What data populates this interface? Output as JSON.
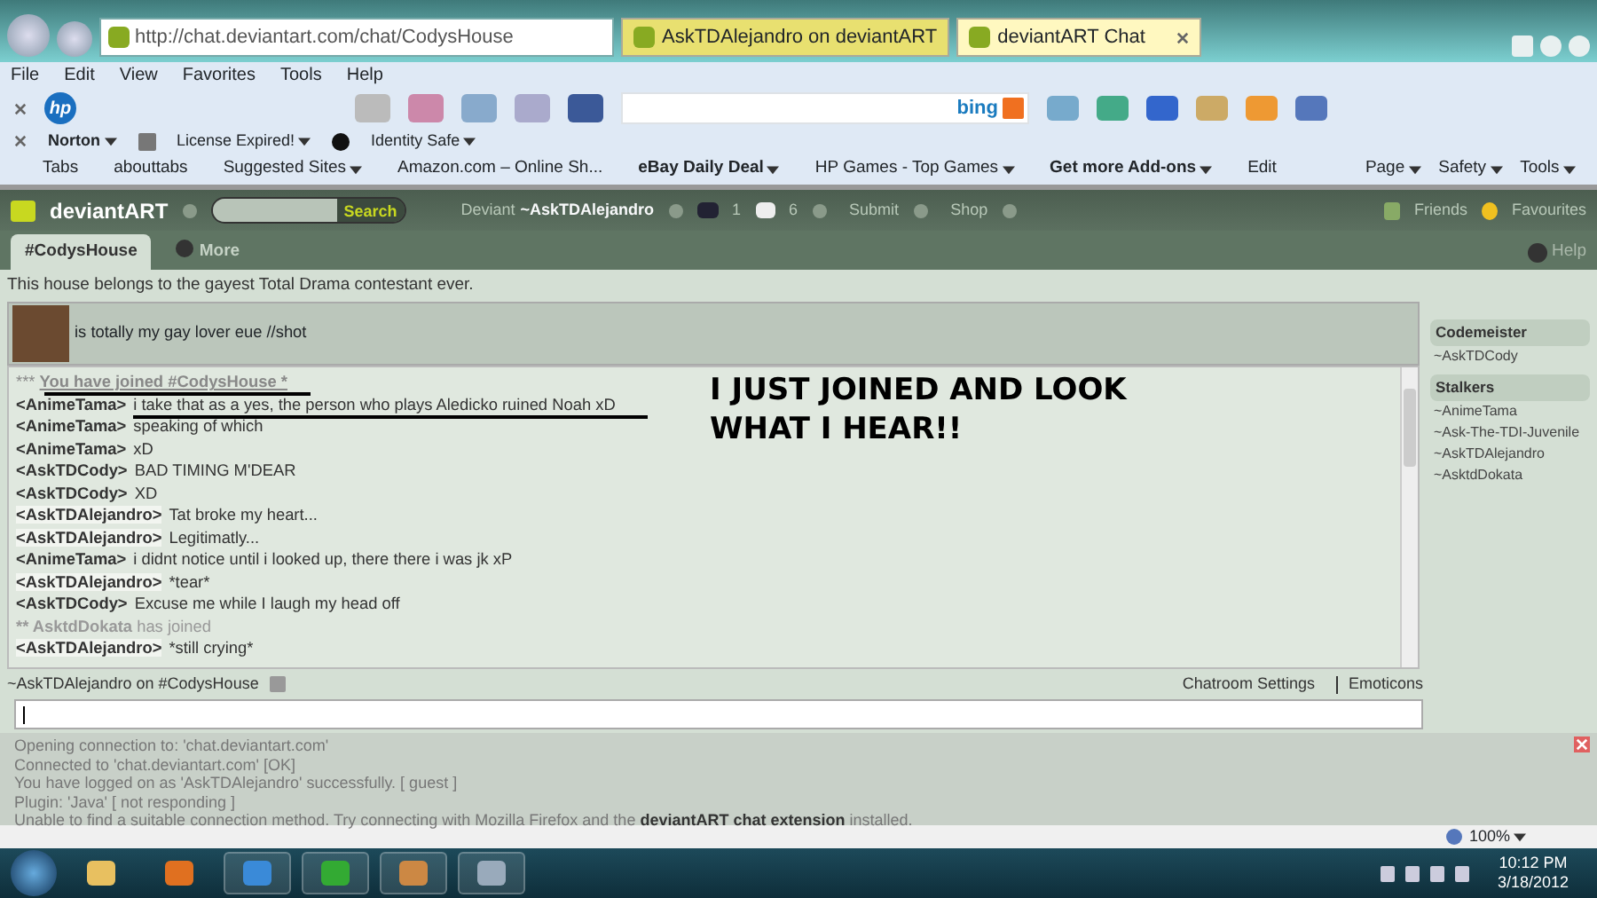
{
  "browser": {
    "address": "http://chat.deviantart.com/chat/CodysHouse",
    "tabs": [
      {
        "label": "AskTDAlejandro on deviantART",
        "selected": false
      },
      {
        "label": "deviantART Chat",
        "selected": true
      }
    ],
    "menu": [
      "File",
      "Edit",
      "View",
      "Favorites",
      "Tools",
      "Help"
    ],
    "hp_logo": "hp",
    "search_logo": "bing",
    "norton": {
      "brand": "Norton",
      "items": [
        "License Expired!",
        "Identity Safe"
      ]
    },
    "favorites": [
      "Tabs",
      "abouttabs",
      "Suggested Sites",
      "Amazon.com – Online Sh...",
      "eBay Daily Deal",
      "HP Games - Top Games",
      "Get more Add-ons",
      "Edit"
    ],
    "command_bar": [
      "Page",
      "Safety",
      "Tools"
    ]
  },
  "header": {
    "logo": "deviantART",
    "search_button": "Search",
    "user_prefix": "Deviant",
    "user": "~AskTDAlejandro",
    "watch_count": "1",
    "message_count": "6",
    "nav": [
      "Submit",
      "Shop"
    ],
    "right": [
      "Friends",
      "Favourites"
    ]
  },
  "room_tabs": [
    {
      "label": "#CodysHouse",
      "selected": true
    },
    {
      "label": "More",
      "selected": false
    }
  ],
  "help": "Help",
  "topic": "This house belongs to the gayest Total Drama contestant ever.",
  "pinned": {
    "text": "is totally my gay lover eue //shot"
  },
  "messages": [
    {
      "kind": "system",
      "prefix": "***",
      "text": "You have joined #CodysHouse *"
    },
    {
      "kind": "message",
      "user": "<AnimeTama>",
      "self": false,
      "text": "i take that as a yes, the person who plays Aledicko ruined Noah xD"
    },
    {
      "kind": "message",
      "user": "<AnimeTama>",
      "self": false,
      "text": "speaking of which"
    },
    {
      "kind": "message",
      "user": "<AnimeTama>",
      "self": false,
      "text": "xD"
    },
    {
      "kind": "message",
      "user": "<AskTDCody>",
      "self": false,
      "text": "BAD TIMING M'DEAR"
    },
    {
      "kind": "message",
      "user": "<AskTDCody>",
      "self": false,
      "text": "XD"
    },
    {
      "kind": "message",
      "user": "<AskTDAlejandro>",
      "self": true,
      "text": "Tat broke my heart..."
    },
    {
      "kind": "message",
      "user": "<AskTDAlejandro>",
      "self": true,
      "text": "Legitimatly..."
    },
    {
      "kind": "message",
      "user": "<AnimeTama>",
      "self": false,
      "text": "i didnt notice until i looked up, there there i was jk xP"
    },
    {
      "kind": "message",
      "user": "<AskTDAlejandro>",
      "self": true,
      "text": "*tear*"
    },
    {
      "kind": "message",
      "user": "<AskTDCody>",
      "self": false,
      "text": "Excuse me while I laugh my head off"
    },
    {
      "kind": "join",
      "prefix": "**",
      "user": "AsktdDokata",
      "text": "has joined"
    },
    {
      "kind": "message",
      "user": "<AskTDAlejandro>",
      "self": true,
      "text": "*still crying*"
    }
  ],
  "annotation": "I JUST JOINED AND LOOK WHAT I HEAR!!",
  "members": [
    {
      "role": "Codemeister",
      "users": [
        "~AskTDCody"
      ]
    },
    {
      "role": "Stalkers",
      "users": [
        "~AnimeTama",
        "~Ask-The-TDI-Juvenile",
        "~AskTDAlejandro",
        "~AsktdDokata"
      ]
    }
  ],
  "status": {
    "text": "~AskTDAlejandro on #CodysHouse",
    "links": [
      "Chatroom Settings",
      "Emoticons"
    ]
  },
  "log": [
    "Opening connection to: 'chat.deviantart.com'",
    "Connected to 'chat.deviantart.com' [OK]",
    "You have logged on as 'AskTDAlejandro' successfully. [ guest ]",
    "Plugin: 'Java' [ not responding ]",
    "Unable to find a suitable connection method. Try connecting with Mozilla Firefox and the **deviantART chat extension** installed."
  ],
  "ie_status": {
    "zoom": "100%"
  },
  "taskbar": {
    "time": "10:12 PM",
    "date": "3/18/2012"
  }
}
